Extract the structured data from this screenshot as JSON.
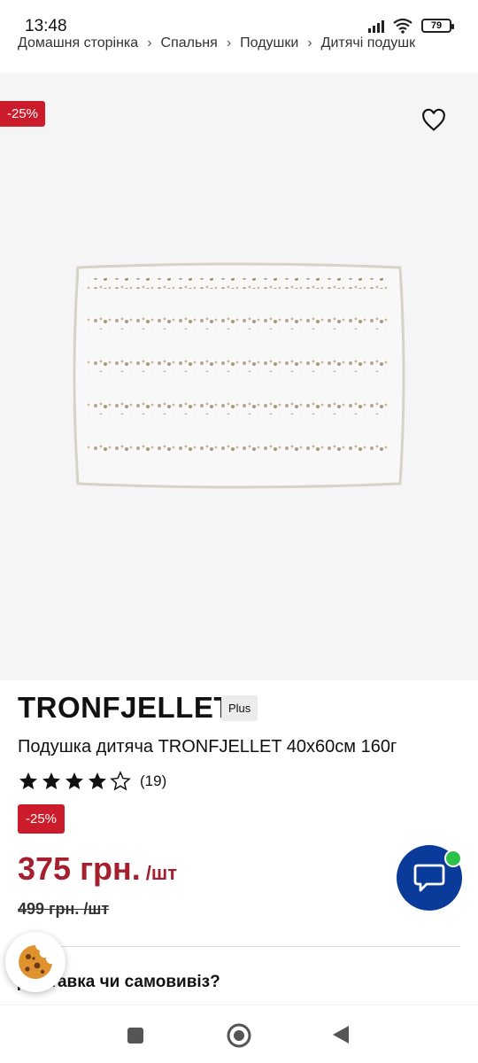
{
  "status": {
    "time": "13:48",
    "battery": "79"
  },
  "breadcrumb": [
    "Домашня сторінка",
    "Спальня",
    "Подушки",
    "Дитячі подушк"
  ],
  "badges": {
    "discount": "-25%",
    "plus": "Plus"
  },
  "product": {
    "brand": "TRONFJELLET",
    "description": "Подушка дитяча TRONFJELLET 40x60см 160г",
    "rating": {
      "value": 4,
      "max": 5,
      "count": "(19)"
    },
    "price": "375 грн.",
    "price_unit": "/шт",
    "old_price": "499 грн. /шт"
  },
  "delivery": {
    "text": "Доставка чи самовивіз?"
  },
  "colors": {
    "accent_red": "#cc1b2b",
    "price_red": "#a5202e",
    "chat_blue": "#0a3a9a",
    "online_green": "#2ec14a"
  },
  "icons": [
    "heart-icon",
    "star-icon",
    "chat-icon",
    "cookie-icon",
    "nav-recents-icon",
    "nav-home-icon",
    "nav-back-icon"
  ]
}
